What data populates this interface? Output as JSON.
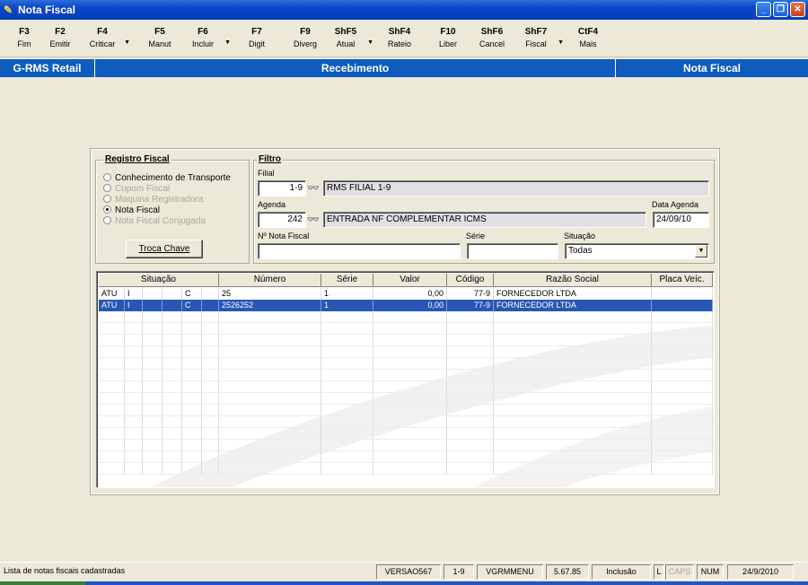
{
  "window": {
    "title": "Nota Fiscal"
  },
  "toolbar": [
    {
      "key": "F3",
      "label": "Fim",
      "dd": false
    },
    {
      "key": "F2",
      "label": "Emitir",
      "dd": false
    },
    {
      "key": "F4",
      "label": "Criticar",
      "dd": true
    },
    {
      "key": "F5",
      "label": "Manut",
      "dd": false
    },
    {
      "key": "F6",
      "label": "Incluir",
      "dd": true
    },
    {
      "key": "F7",
      "label": "Digit",
      "dd": false
    },
    {
      "key": "F9",
      "label": "Diverg",
      "dd": false
    },
    {
      "key": "ShF5",
      "label": "Atual",
      "dd": true
    },
    {
      "key": "ShF4",
      "label": "Rateio",
      "dd": false
    },
    {
      "key": "F10",
      "label": "Liber",
      "dd": false
    },
    {
      "key": "ShF6",
      "label": "Cancel",
      "dd": false
    },
    {
      "key": "ShF7",
      "label": "Fiscal",
      "dd": true
    },
    {
      "key": "CtF4",
      "label": "Mais",
      "dd": false
    }
  ],
  "header": {
    "app": "G-RMS Retail",
    "module": "Recebimento",
    "screen": "Nota Fiscal"
  },
  "registro": {
    "legend": "Registro Fiscal",
    "options": [
      {
        "label": "Conhecimento de Transporte",
        "checked": false,
        "enabled": true
      },
      {
        "label": "Cupom Fiscal",
        "checked": false,
        "enabled": false
      },
      {
        "label": "Maquina Registradora",
        "checked": false,
        "enabled": false
      },
      {
        "label": "Nota Fiscal",
        "checked": true,
        "enabled": true
      },
      {
        "label": "Nota Fiscal Conjugada",
        "checked": false,
        "enabled": false
      }
    ],
    "troca_label": "Troca Chave"
  },
  "filtro": {
    "legend": "Filtro",
    "filial_label": "Filial",
    "filial_code": "1-9",
    "filial_name": "RMS FILIAL 1-9",
    "agenda_label": "Agenda",
    "agenda_code": "242",
    "agenda_desc": "ENTRADA NF COMPLEMENTAR ICMS",
    "data_agenda_label": "Data Agenda",
    "data_agenda": "24/09/10",
    "nota_label": "Nº Nota Fiscal",
    "nota_value": "",
    "serie_label": "Série",
    "serie_value": "",
    "situacao_label": "Situação",
    "situacao_value": "Todas"
  },
  "grid": {
    "columns": [
      "Situação",
      "Número",
      "Série",
      "Valor",
      "Código",
      "Razão Social",
      "Placa Veíc."
    ],
    "rows": [
      {
        "sit": [
          "ATU",
          "I",
          "",
          "",
          "C",
          ""
        ],
        "numero": "25",
        "serie": "1",
        "valor": "0,00",
        "codigo": "77-9",
        "razao": "FORNECEDOR LTDA",
        "placa": "",
        "selected": false
      },
      {
        "sit": [
          "ATU",
          "I",
          "",
          "",
          "C",
          ""
        ],
        "numero": "2526252",
        "serie": "1",
        "valor": "0,00",
        "codigo": "77-9",
        "razao": "FORNECEDOR LTDA",
        "placa": "",
        "selected": true
      }
    ]
  },
  "status": {
    "message": "Lista de notas fiscais cadastradas",
    "version": "VERSAO567",
    "filial": "1-9",
    "menu": "VGRMMENU",
    "build": "5.67.85",
    "mode": "Inclusão",
    "l": "L",
    "caps": "CAPS",
    "num": "NUM",
    "date": "24/9/2010"
  },
  "colors": {
    "title_blue": "#0a46c8",
    "header_blue": "#0e5cbd",
    "selection": "#2a57b4",
    "face": "#ece9d8"
  }
}
